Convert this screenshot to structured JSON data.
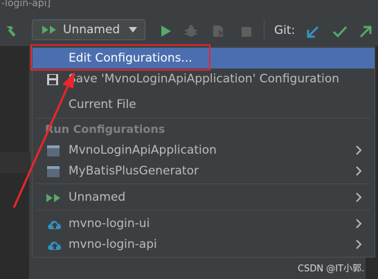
{
  "window": {
    "title_fragment": "-login-api]"
  },
  "toolbar": {
    "run_config_label": "Unnamed",
    "git_label": "Git:"
  },
  "menu": {
    "items": [
      {
        "label": "Edit Configurations...",
        "selected": true,
        "icon": "none"
      },
      {
        "label": "Save 'MvnoLoginApiApplication' Configuration",
        "icon": "save-icon"
      },
      {
        "label": "Current File",
        "icon": "none"
      }
    ],
    "section_header": "Run Configurations",
    "configs": [
      {
        "label": "MvnoLoginApiApplication",
        "icon": "app-window-icon"
      },
      {
        "label": "MyBatisPlusGenerator",
        "icon": "app-window-icon"
      },
      {
        "label": "Unnamed",
        "icon": "run-compound-icon"
      },
      {
        "label": "mvno-login-ui",
        "icon": "cloud-upload-icon"
      },
      {
        "label": "mvno-login-api",
        "icon": "cloud-upload-icon"
      }
    ]
  },
  "watermark": "CSDN @IT小郭.",
  "colors": {
    "selection": "#4b6eaf",
    "annotation": "#e8262d",
    "run_green": "#59a869",
    "git_blue": "#3592c4"
  }
}
